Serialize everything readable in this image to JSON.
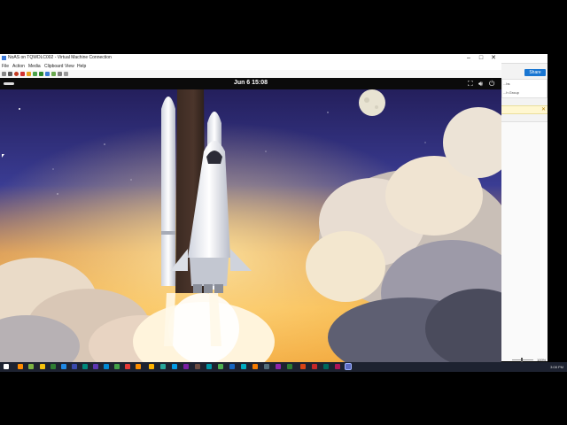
{
  "vm": {
    "title": "NoAS on TQWDLC002 - Virtual Machine Connection",
    "controls": {
      "minimize": "–",
      "maximize": "□",
      "close": "✕"
    },
    "menu": [
      "File",
      "Action",
      "Media",
      "Clipboard",
      "View",
      "Help"
    ]
  },
  "guest": {
    "clock": "Jun 6  15:08"
  },
  "host": {
    "share_label": "Share",
    "panel_lines": [
      "...bs",
      "...h Group"
    ],
    "zoom_label": "100%"
  },
  "taskbar": {
    "time": "3:08 PM"
  },
  "colors": {
    "sky_top": "#241f5c",
    "sky_mid": "#3a3c93",
    "sunset": "#f3a643",
    "taskbar": "#1d2230",
    "topbar": "#0b0b0b"
  }
}
